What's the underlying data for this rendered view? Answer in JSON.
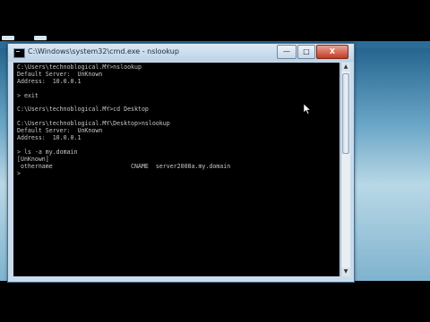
{
  "window": {
    "title": "C:\\Windows\\system32\\cmd.exe - nslookup",
    "buttons": {
      "minimize": "—",
      "maximize": "□",
      "close": "X"
    }
  },
  "console": {
    "lines": [
      "C:\\Users\\technoblogical.MY>nslookup",
      "Default Server:  UnKnown",
      "Address:  10.0.0.1",
      "",
      "> exit",
      "",
      "C:\\Users\\technoblogical.MY>cd Desktop",
      "",
      "C:\\Users\\technoblogical.MY\\Desktop>nslookup",
      "Default Server:  UnKnown",
      "Address:  10.0.0.1",
      "",
      "> ls -a my.domain",
      "[UnKnown]",
      " othername                      CNAME  server2008a.my.domain",
      ">"
    ]
  },
  "scrollbar": {
    "up": "▲",
    "down": "▼"
  },
  "icons": {
    "window_icon": "cmd-console-icon",
    "cursor": "mouse-pointer-icon"
  }
}
